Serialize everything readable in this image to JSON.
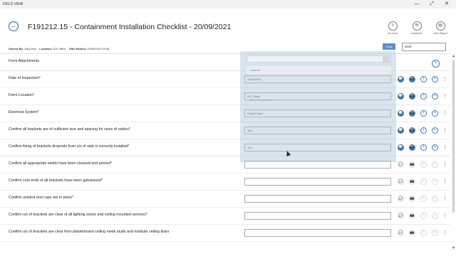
{
  "app": {
    "title": "FIELD VIEW"
  },
  "window_controls": {
    "minimize": "—",
    "restore": "⤢",
    "close": "✕"
  },
  "header": {
    "back_icon": "arrow-left-icon",
    "title": "F191212.15 - Containment Installation Checklist - 20/09/2021",
    "actions": [
      {
        "label": "All Good",
        "icon": "all-good-icon",
        "glyph": "≡"
      },
      {
        "label": "Distribute",
        "icon": "distribute-icon",
        "glyph": "✉"
      },
      {
        "label": "View Report",
        "icon": "report-icon",
        "glyph": "▤"
      }
    ]
  },
  "meta": {
    "owned_by_label": "Owned By:",
    "owned_by": "Gary Kirk",
    "location_label": "Location:",
    "location": "001 Office",
    "date_raised_label": "Date Raised:",
    "date_raised": "20/09/2021 09:38",
    "copy_label": "Copy",
    "status": "Draft"
  },
  "overlay": {
    "sub_text": "Cleared",
    "hint": "Enter Form Location"
  },
  "rows": [
    {
      "label": "Form Attachments",
      "value": ""
    },
    {
      "label": "Date of Inspection*",
      "value": "20/09/2021"
    },
    {
      "label": "Form Location*",
      "value": "001 Office"
    },
    {
      "label": "Electrical System*",
      "value": "Small Power"
    },
    {
      "label": "Confirm all brackets are of sufficient size and spacing for sizes of cables*",
      "value": "Yes"
    },
    {
      "label": "Confirm fixing of brackets droprods from u/s of slab is correctly installed*",
      "value": "Yes"
    },
    {
      "label": "Confirm all appropriate welds have been cleaned and primed*",
      "value": ""
    },
    {
      "label": "Confirm cuts ends of all brackets have been galvanised*",
      "value": ""
    },
    {
      "label": "Confirm unistrut end caps are in place*",
      "value": ""
    },
    {
      "label": "Confirm u/s of brackets are clear of all lighting zones and ceiling mounted services*",
      "value": ""
    },
    {
      "label": "Confirm u/s of brackets are clear from plasterboard ceiling metal studs and modular ceiling tbars",
      "value": ""
    }
  ],
  "row_icons": {
    "comment": "💬",
    "camera": "📷",
    "info": "f",
    "attach": "✎",
    "more": "⋮"
  },
  "colors": {
    "accent": "#3f78b5",
    "copy_button": "#5a8fc7",
    "overlay": "#adc4d4"
  }
}
